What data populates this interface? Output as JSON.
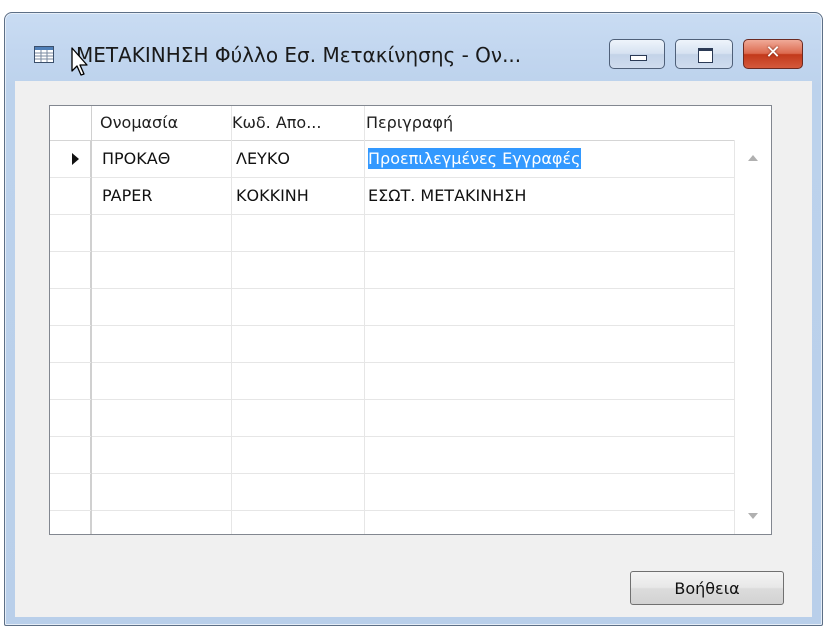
{
  "window": {
    "title": "ΜΕΤΑΚΙΝΗΣΗ Φύλλο Εσ. Μετακίνησης - Ον...",
    "icon": "table-icon",
    "controls": {
      "minimize": "minimize-icon",
      "maximize": "maximize-icon",
      "close": "close-icon"
    }
  },
  "grid": {
    "columns": [
      "Ονομασία",
      "Κωδ. Απο...",
      "Περιγραφή"
    ],
    "rows": [
      {
        "name": "ΠΡΟΚΑΘ",
        "code": "ΛΕΥΚΟ",
        "description": "Προεπιλεγμένες Εγγραφές",
        "current": true
      },
      {
        "name": "PAPER",
        "code": "ΚΟΚΚΙΝΗ",
        "description": "ΕΣΩΤ. ΜΕΤΑΚΙΝΗΣΗ",
        "current": false
      }
    ],
    "empty_rows": 9
  },
  "buttons": {
    "help": "Βοήθεια"
  },
  "colors": {
    "selection": "#3399ff",
    "frame": "#bcd2ec",
    "close": "#c2391b"
  }
}
